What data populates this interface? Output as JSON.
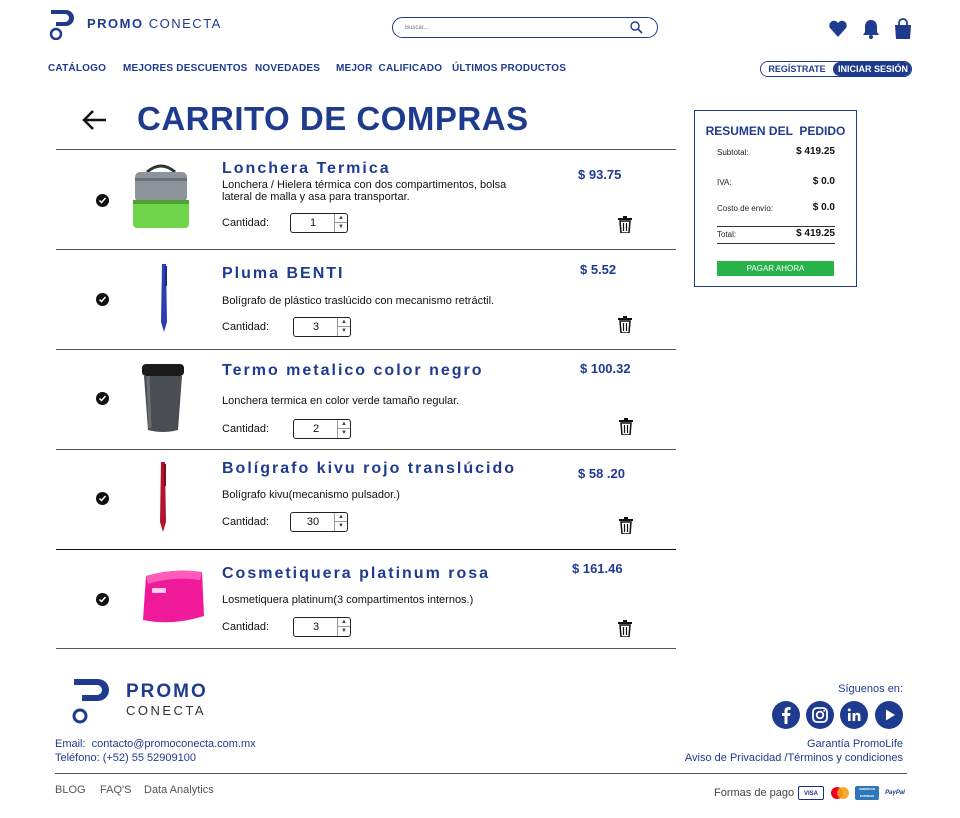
{
  "brand": {
    "primary": "#1f3b8f",
    "green": "#27b24a",
    "logo_word1": "PROMO",
    "logo_word2": "CONECTA"
  },
  "search": {
    "placeholder": "Buscar..."
  },
  "header_icons": [
    "heart-icon",
    "bell-icon",
    "shopping-bag-icon"
  ],
  "nav": {
    "items": [
      {
        "label": "CATÁLOGO"
      },
      {
        "label": "MEJORES DESCUENTOS"
      },
      {
        "label": "NOVEDADES"
      },
      {
        "label": "MEJOR  CALIFICADO"
      },
      {
        "label": "ÚLTIMOS PRODUCTOS"
      }
    ]
  },
  "auth": {
    "register": "REGÍSTRATE",
    "login": "INICIAR SESIÓN"
  },
  "page_title": "CARRITO DE COMPRAS",
  "cart": {
    "qty_label": "Cantidad:",
    "items": [
      {
        "name": "Lonchera Termica",
        "desc": "Lonchera / Hielera térmica con dos compartimentos, bolsa lateral de malla y asa para transportar.",
        "qty": "1",
        "price": "$ 93.75",
        "checked": true
      },
      {
        "name": "Pluma BENTI",
        "desc": "Bolígrafo de plástico traslúcido con mecanismo retráctil.",
        "qty": "3",
        "price": "$ 5.52",
        "checked": true
      },
      {
        "name": "Termo metalico color negro",
        "desc": "Lonchera termica en color verde tamaño regular.",
        "qty": "2",
        "price": "$ 100.32",
        "checked": true
      },
      {
        "name": "Bolígrafo kivu rojo translúcido",
        "desc": "Bolígrafo kivu(mecanismo pulsador.)",
        "qty": "30",
        "price": "$ 58 .20",
        "checked": true
      },
      {
        "name": "Cosmetiquera platinum rosa",
        "desc": "Losmetiquera platinum(3 compartimentos internos.)",
        "qty": "3",
        "price": "$ 161.46",
        "checked": true
      }
    ]
  },
  "summary": {
    "title": "RESUMEN DEL  PEDIDO",
    "subtotal_label": "Subtotal:",
    "subtotal": "$ 419.25",
    "iva_label": "IVA:",
    "iva": "$ 0.0",
    "shipping_label": "Costo de envío:",
    "shipping": "$ 0.0",
    "total_label": "Total:",
    "total": "$ 419.25",
    "pay_button": "PAGAR AHORA"
  },
  "footer": {
    "email": "Email:  contacto@promoconecta.com.mx",
    "phone": "Teléfono: (+52) 55 52909100",
    "follow": "Síguenos en:",
    "social": [
      "facebook-icon",
      "instagram-icon",
      "linkedin-icon",
      "youtube-icon"
    ],
    "guarantee": "Garantía PromoLife",
    "privacy": "Aviso de Privacidad /Términos y condiciones",
    "links": [
      "BLOG",
      "FAQ'S",
      "Data Analytics"
    ],
    "payment_label": "Formas de pago",
    "cards": [
      "VISA",
      "MasterCard",
      "AMERICAN EXPRESS",
      "PayPal"
    ]
  }
}
